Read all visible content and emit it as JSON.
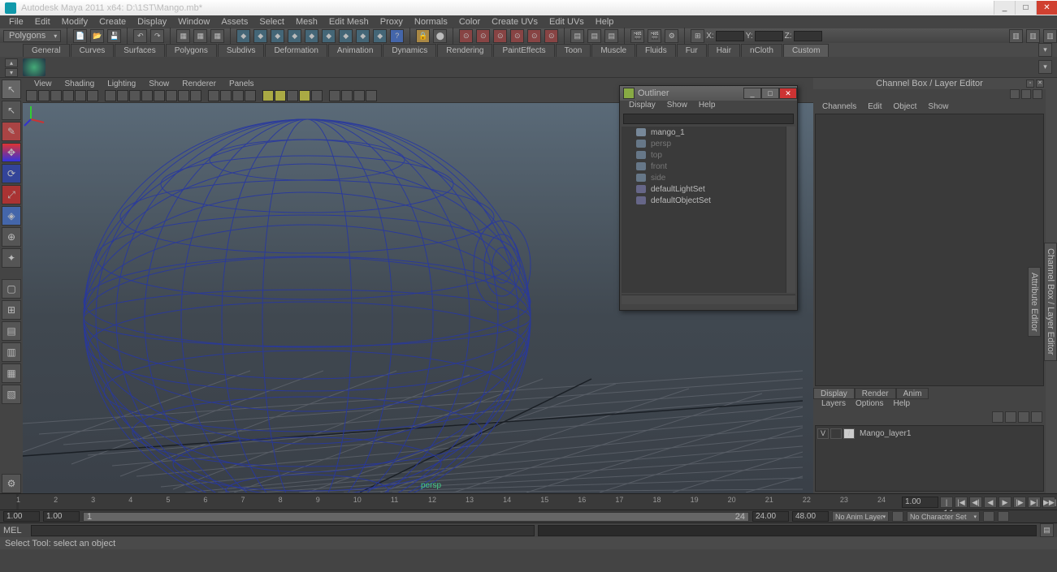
{
  "window": {
    "title": "Autodesk Maya 2011 x64: D:\\1ST\\Mango.mb*"
  },
  "menus": [
    "File",
    "Edit",
    "Modify",
    "Create",
    "Display",
    "Window",
    "Assets",
    "Select",
    "Mesh",
    "Edit Mesh",
    "Proxy",
    "Normals",
    "Color",
    "Create UVs",
    "Edit UVs",
    "Help"
  ],
  "moduleDropdown": "Polygons",
  "xyz": {
    "x": "X:",
    "y": "Y:",
    "z": "Z:"
  },
  "shelves": [
    "General",
    "Curves",
    "Surfaces",
    "Polygons",
    "Subdivs",
    "Deformation",
    "Animation",
    "Dynamics",
    "Rendering",
    "PaintEffects",
    "Toon",
    "Muscle",
    "Fluids",
    "Fur",
    "Hair",
    "nCloth",
    "Custom"
  ],
  "viewportMenus": [
    "View",
    "Shading",
    "Lighting",
    "Show",
    "Renderer",
    "Panels"
  ],
  "perspLabel": "persp",
  "outliner": {
    "title": "Outliner",
    "menus": [
      "Display",
      "Show",
      "Help"
    ],
    "search": "",
    "items": [
      {
        "label": "mango_1",
        "cam": false,
        "dim": false
      },
      {
        "label": "persp",
        "cam": true,
        "dim": true
      },
      {
        "label": "top",
        "cam": true,
        "dim": true
      },
      {
        "label": "front",
        "cam": true,
        "dim": true
      },
      {
        "label": "side",
        "cam": true,
        "dim": true
      },
      {
        "label": "defaultLightSet",
        "cam": false,
        "dim": false,
        "set": true
      },
      {
        "label": "defaultObjectSet",
        "cam": false,
        "dim": false,
        "set": true
      }
    ]
  },
  "channelBox": {
    "title": "Channel Box / Layer Editor",
    "menus": [
      "Channels",
      "Edit",
      "Object",
      "Show"
    ]
  },
  "layerEditor": {
    "tabs": [
      "Display",
      "Render",
      "Anim"
    ],
    "menus": [
      "Layers",
      "Options",
      "Help"
    ],
    "layer": {
      "v": "V",
      "name": "Mango_layer1"
    }
  },
  "timeline": {
    "ticks": [
      "1",
      "2",
      "3",
      "4",
      "5",
      "6",
      "7",
      "8",
      "9",
      "10",
      "11",
      "12",
      "13",
      "14",
      "15",
      "16",
      "17",
      "18",
      "19",
      "20",
      "21",
      "22",
      "23",
      "24"
    ],
    "current": "1.00"
  },
  "range": {
    "startOuter": "1.00",
    "startInner": "1.00",
    "sliderStart": "1",
    "sliderEnd": "24",
    "endInner": "24.00",
    "endOuter": "48.00",
    "animLayer": "No Anim Layer",
    "charSet": "No Character Set"
  },
  "cmd": {
    "lang": "MEL"
  },
  "help": "Select Tool: select an object",
  "sideTabs": [
    "Channel Box / Layer Editor",
    "Attribute Editor"
  ]
}
